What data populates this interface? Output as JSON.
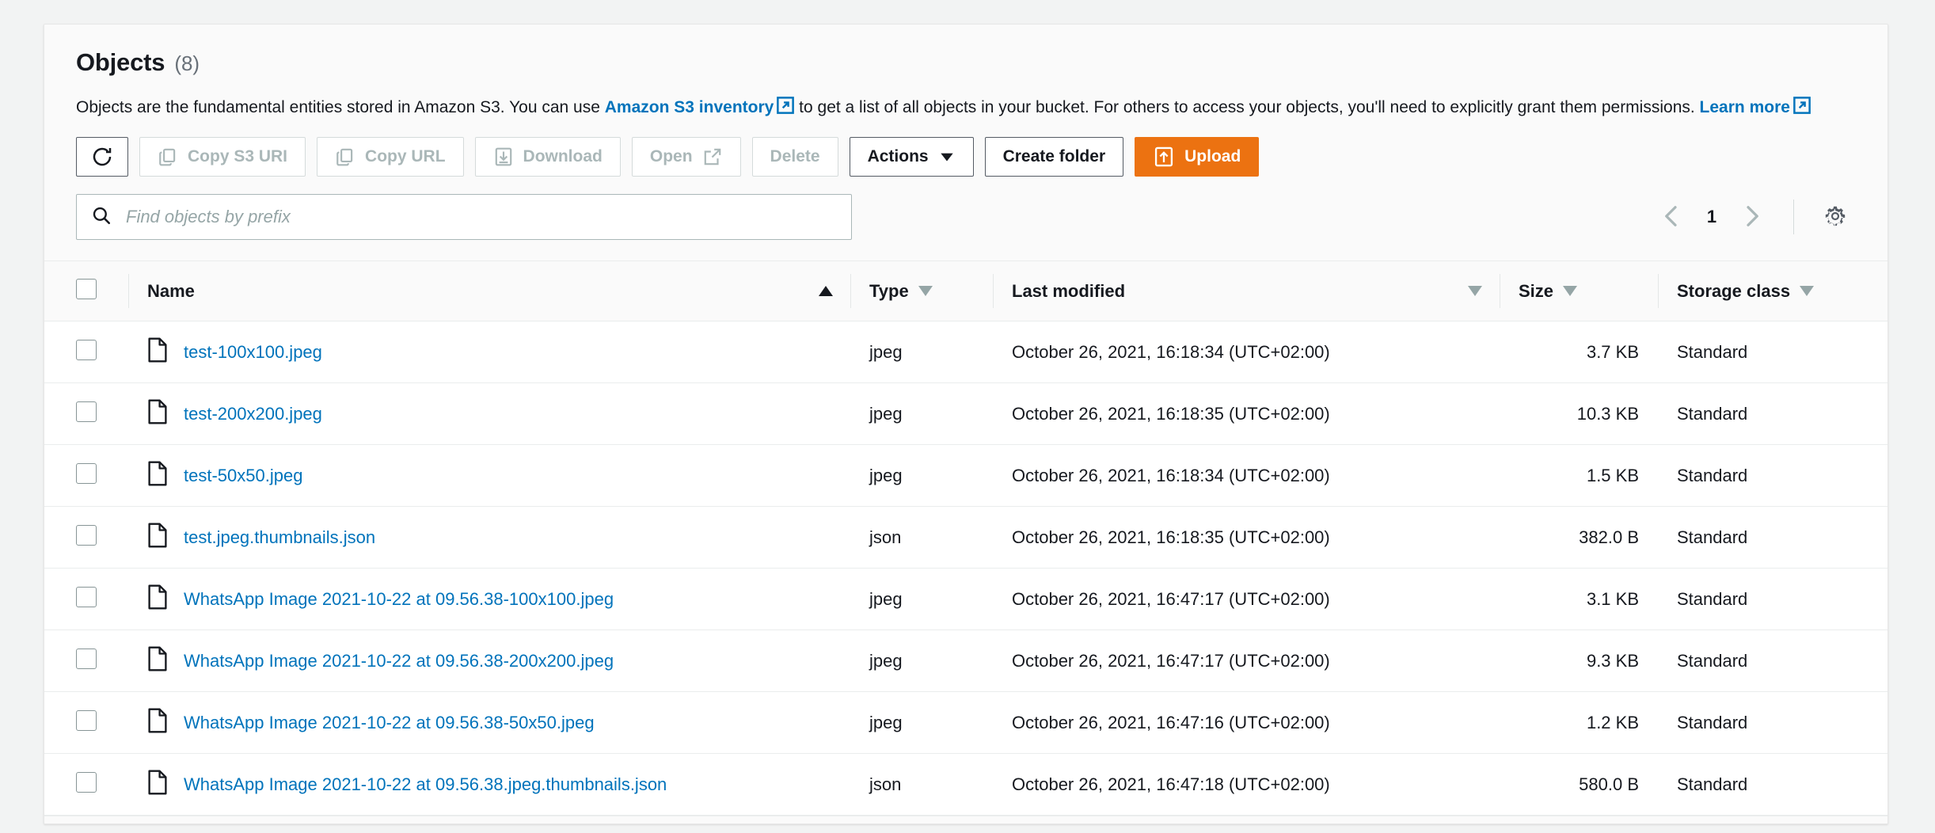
{
  "panel": {
    "title": "Objects",
    "count": "(8)",
    "description_part1": "Objects are the fundamental entities stored in Amazon S3. You can use ",
    "inventory_link": "Amazon S3 inventory",
    "description_part2": " to get a list of all objects in your bucket. For others to access your objects, you'll need to explicitly grant them permissions. ",
    "learn_more_link": "Learn more"
  },
  "toolbar": {
    "refresh_label": "",
    "copy_s3_uri_label": "Copy S3 URI",
    "copy_url_label": "Copy URL",
    "download_label": "Download",
    "open_label": "Open",
    "delete_label": "Delete",
    "actions_label": "Actions",
    "create_folder_label": "Create folder",
    "upload_label": "Upload"
  },
  "search": {
    "placeholder": "Find objects by prefix",
    "value": ""
  },
  "pagination": {
    "current_page": "1"
  },
  "table": {
    "columns": [
      {
        "label": "Name",
        "sort": "asc"
      },
      {
        "label": "Type",
        "sort": "none"
      },
      {
        "label": "Last modified",
        "sort": "none"
      },
      {
        "label": "Size",
        "sort": "none"
      },
      {
        "label": "Storage class",
        "sort": "none"
      }
    ],
    "rows": [
      {
        "name": "test-100x100.jpeg",
        "type": "jpeg",
        "last_modified": "October 26, 2021, 16:18:34 (UTC+02:00)",
        "size": "3.7 KB",
        "storage_class": "Standard"
      },
      {
        "name": "test-200x200.jpeg",
        "type": "jpeg",
        "last_modified": "October 26, 2021, 16:18:35 (UTC+02:00)",
        "size": "10.3 KB",
        "storage_class": "Standard"
      },
      {
        "name": "test-50x50.jpeg",
        "type": "jpeg",
        "last_modified": "October 26, 2021, 16:18:34 (UTC+02:00)",
        "size": "1.5 KB",
        "storage_class": "Standard"
      },
      {
        "name": "test.jpeg.thumbnails.json",
        "type": "json",
        "last_modified": "October 26, 2021, 16:18:35 (UTC+02:00)",
        "size": "382.0 B",
        "storage_class": "Standard"
      },
      {
        "name": "WhatsApp Image 2021-10-22 at 09.56.38-100x100.jpeg",
        "type": "jpeg",
        "last_modified": "October 26, 2021, 16:47:17 (UTC+02:00)",
        "size": "3.1 KB",
        "storage_class": "Standard"
      },
      {
        "name": "WhatsApp Image 2021-10-22 at 09.56.38-200x200.jpeg",
        "type": "jpeg",
        "last_modified": "October 26, 2021, 16:47:17 (UTC+02:00)",
        "size": "9.3 KB",
        "storage_class": "Standard"
      },
      {
        "name": "WhatsApp Image 2021-10-22 at 09.56.38-50x50.jpeg",
        "type": "jpeg",
        "last_modified": "October 26, 2021, 16:47:16 (UTC+02:00)",
        "size": "1.2 KB",
        "storage_class": "Standard"
      },
      {
        "name": "WhatsApp Image 2021-10-22 at 09.56.38.jpeg.thumbnails.json",
        "type": "json",
        "last_modified": "October 26, 2021, 16:47:18 (UTC+02:00)",
        "size": "580.0 B",
        "storage_class": "Standard"
      }
    ]
  },
  "colors": {
    "link": "#0073bb",
    "primary_button": "#ec7211",
    "disabled_text": "#aab7b8",
    "text": "#16191f"
  }
}
